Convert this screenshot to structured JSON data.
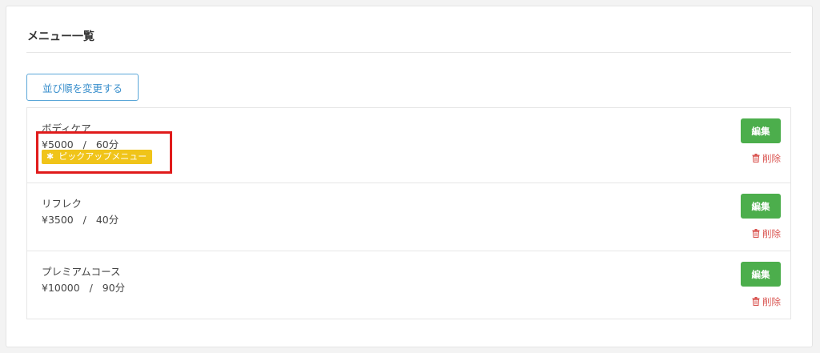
{
  "page": {
    "title": "メニュー一覧",
    "reorder_label": "並び順を変更する"
  },
  "menu": {
    "items": [
      {
        "name": "ボディケア",
        "price_duration": "¥5000   /   60分",
        "badge": "ピックアップメニュー",
        "badge_icon": "✱"
      },
      {
        "name": "リフレク",
        "price_duration": "¥3500   /   40分"
      },
      {
        "name": "プレミアムコース",
        "price_duration": "¥10000   /   90分"
      }
    ],
    "edit_label": "編集",
    "delete_label": "削除"
  },
  "colors": {
    "accent_blue": "#3a8fcc",
    "edit_green": "#4cae4c",
    "delete_red": "#d9534f",
    "badge_yellow": "#f0c419",
    "highlight_red": "#e01b1b"
  }
}
